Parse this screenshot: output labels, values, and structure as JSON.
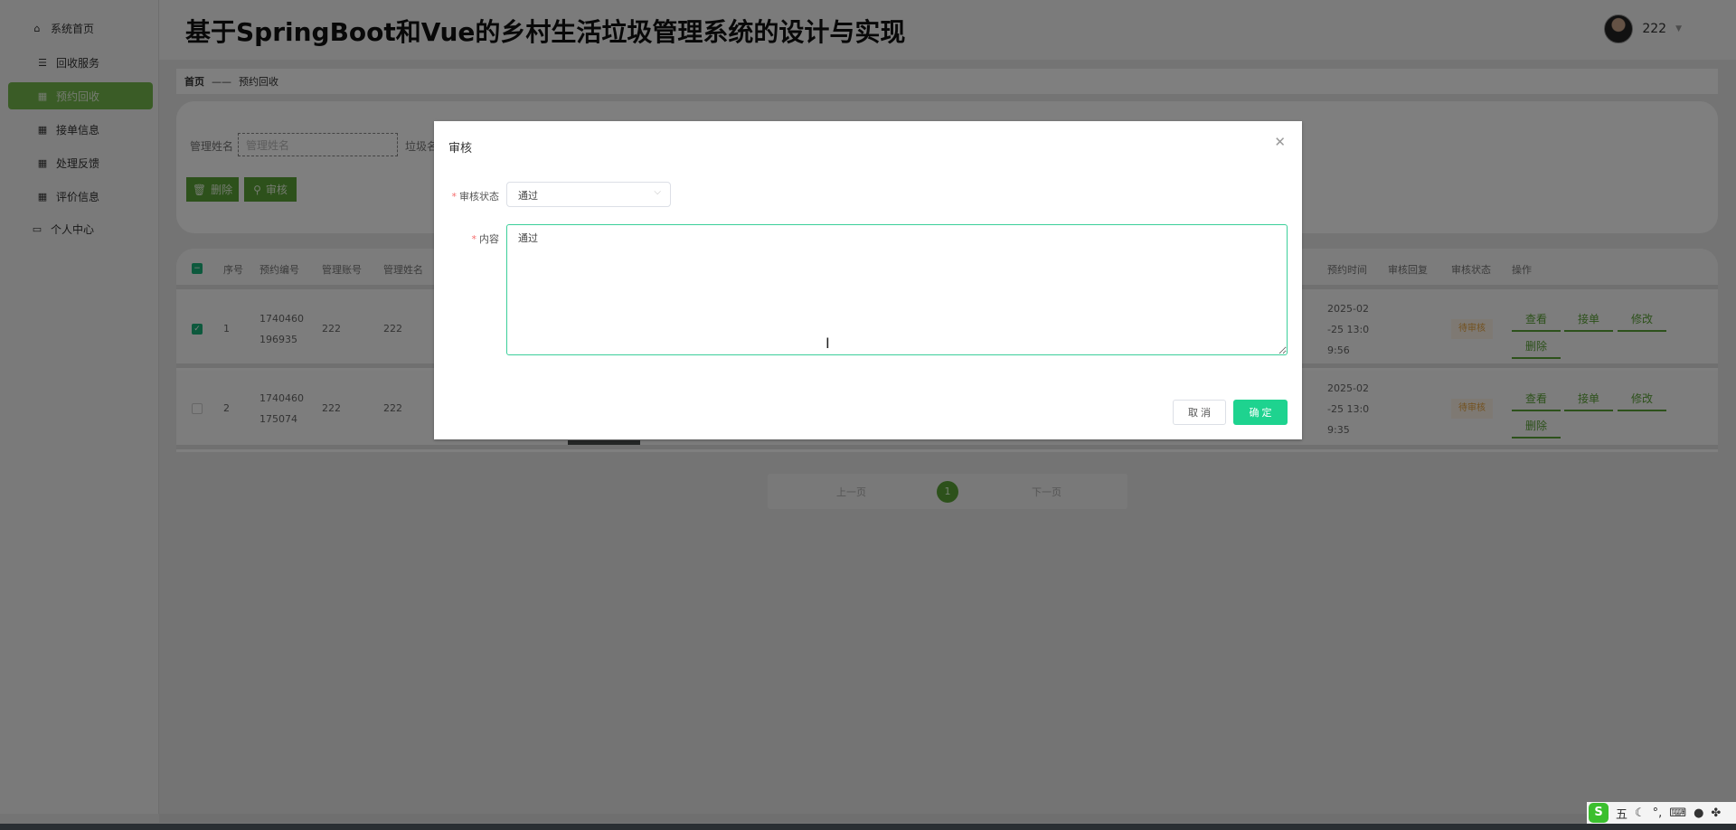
{
  "app_title": "基于SpringBoot和Vue的乡村生活垃圾管理系统的设计与实现",
  "user": {
    "name": "222"
  },
  "sidebar": {
    "items": [
      {
        "label": "系统首页",
        "icon": "home-icon"
      },
      {
        "label": "回收服务",
        "icon": "list-icon"
      },
      {
        "label": "预约回收",
        "icon": "grid-icon",
        "active": true
      },
      {
        "label": "接单信息",
        "icon": "grid-icon"
      },
      {
        "label": "处理反馈",
        "icon": "grid-icon"
      },
      {
        "label": "评价信息",
        "icon": "grid-icon"
      },
      {
        "label": "个人中心",
        "icon": "card-icon"
      }
    ]
  },
  "breadcrumb": {
    "home": "首页",
    "separator": "——",
    "current": "预约回收"
  },
  "search": {
    "label": "管理姓名",
    "placeholder": "管理姓名",
    "label2": "垃圾名"
  },
  "toolbar": {
    "delete": "删除",
    "audit": "审核"
  },
  "table": {
    "columns": [
      "序号",
      "预约编号",
      "管理账号",
      "管理姓名",
      "预约时间",
      "审核回复",
      "审核状态",
      "操作"
    ],
    "rows": [
      {
        "checked": true,
        "index": "1",
        "id_line1": "1740460",
        "id_line2": "196935",
        "account": "222",
        "name": "222",
        "time_line1": "2025-02",
        "time_line2": "-25 13:0",
        "time_line3": "9:56",
        "reply": "",
        "status": "待审核"
      },
      {
        "checked": false,
        "index": "2",
        "id_line1": "1740460",
        "id_line2": "175074",
        "account": "222",
        "name": "222",
        "time_line1": "2025-02",
        "time_line2": "-25 13:0",
        "time_line3": "9:35",
        "reply": "",
        "status": "待审核"
      }
    ],
    "actions": {
      "view": "查看",
      "accept": "接单",
      "edit": "修改",
      "delete": "删除"
    }
  },
  "pagination": {
    "prev": "上一页",
    "current": "1",
    "next": "下一页"
  },
  "dialog": {
    "title": "审核",
    "status_label": "审核状态",
    "status_value": "通过",
    "content_label": "内容",
    "content_value": "通过",
    "cancel": "取 消",
    "confirm": "确 定"
  },
  "ime": {
    "mode": "五"
  },
  "colors": {
    "accent_green": "#5aa336",
    "confirm": "#1ed38f",
    "warning": "#e6a23c"
  }
}
